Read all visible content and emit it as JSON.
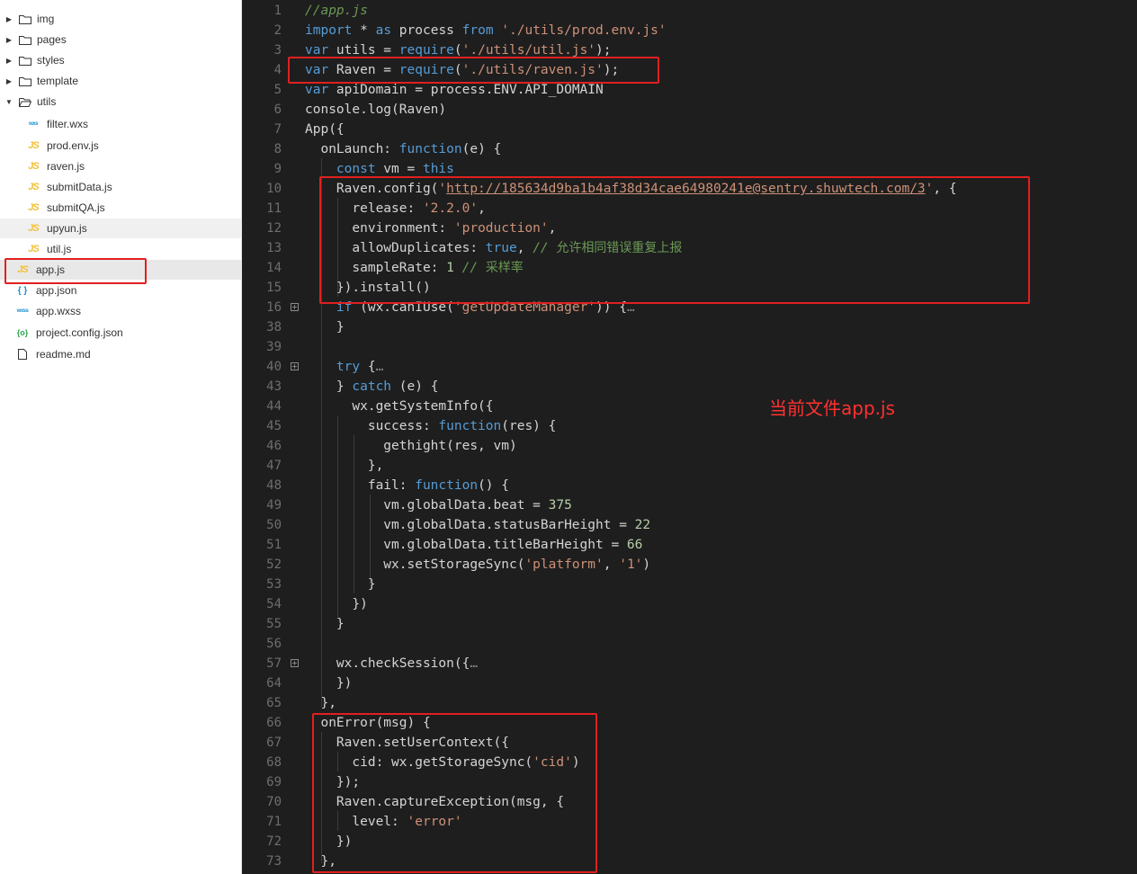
{
  "sidebar": {
    "folders": [
      {
        "label": "img"
      },
      {
        "label": "pages"
      },
      {
        "label": "styles"
      },
      {
        "label": "template"
      },
      {
        "label": "utils"
      }
    ],
    "files": [
      {
        "label": "filter.wxs",
        "icon": "wxs"
      },
      {
        "label": "prod.env.js",
        "icon": "JS"
      },
      {
        "label": "raven.js",
        "icon": "JS"
      },
      {
        "label": "submitData.js",
        "icon": "JS"
      },
      {
        "label": "submitQA.js",
        "icon": "JS"
      },
      {
        "label": "upyun.js",
        "icon": "JS"
      },
      {
        "label": "util.js",
        "icon": "JS"
      },
      {
        "label": "app.js",
        "icon": "JS"
      },
      {
        "label": "app.json",
        "icon": "{ }"
      },
      {
        "label": "app.wxss",
        "icon": "wxss"
      },
      {
        "label": "project.config.json",
        "icon": "{o}"
      },
      {
        "label": "readme.md",
        "icon": ""
      }
    ]
  },
  "editor": {
    "line_numbers": [
      "1",
      "2",
      "3",
      "4",
      "5",
      "6",
      "7",
      "8",
      "9",
      "10",
      "11",
      "12",
      "13",
      "14",
      "15",
      "16",
      "38",
      "39",
      "40",
      "43",
      "44",
      "45",
      "46",
      "47",
      "48",
      "49",
      "50",
      "51",
      "52",
      "53",
      "54",
      "55",
      "56",
      "57",
      "64",
      "65",
      "66",
      "67",
      "68",
      "69",
      "70",
      "71",
      "72",
      "73"
    ],
    "annotation": "当前文件app.js"
  },
  "colors": {
    "highlight_box": "#e02020",
    "editor_bg": "#1e1e1e",
    "keyword": "#569cd6",
    "string": "#ce9178",
    "comment": "#6a9955"
  }
}
